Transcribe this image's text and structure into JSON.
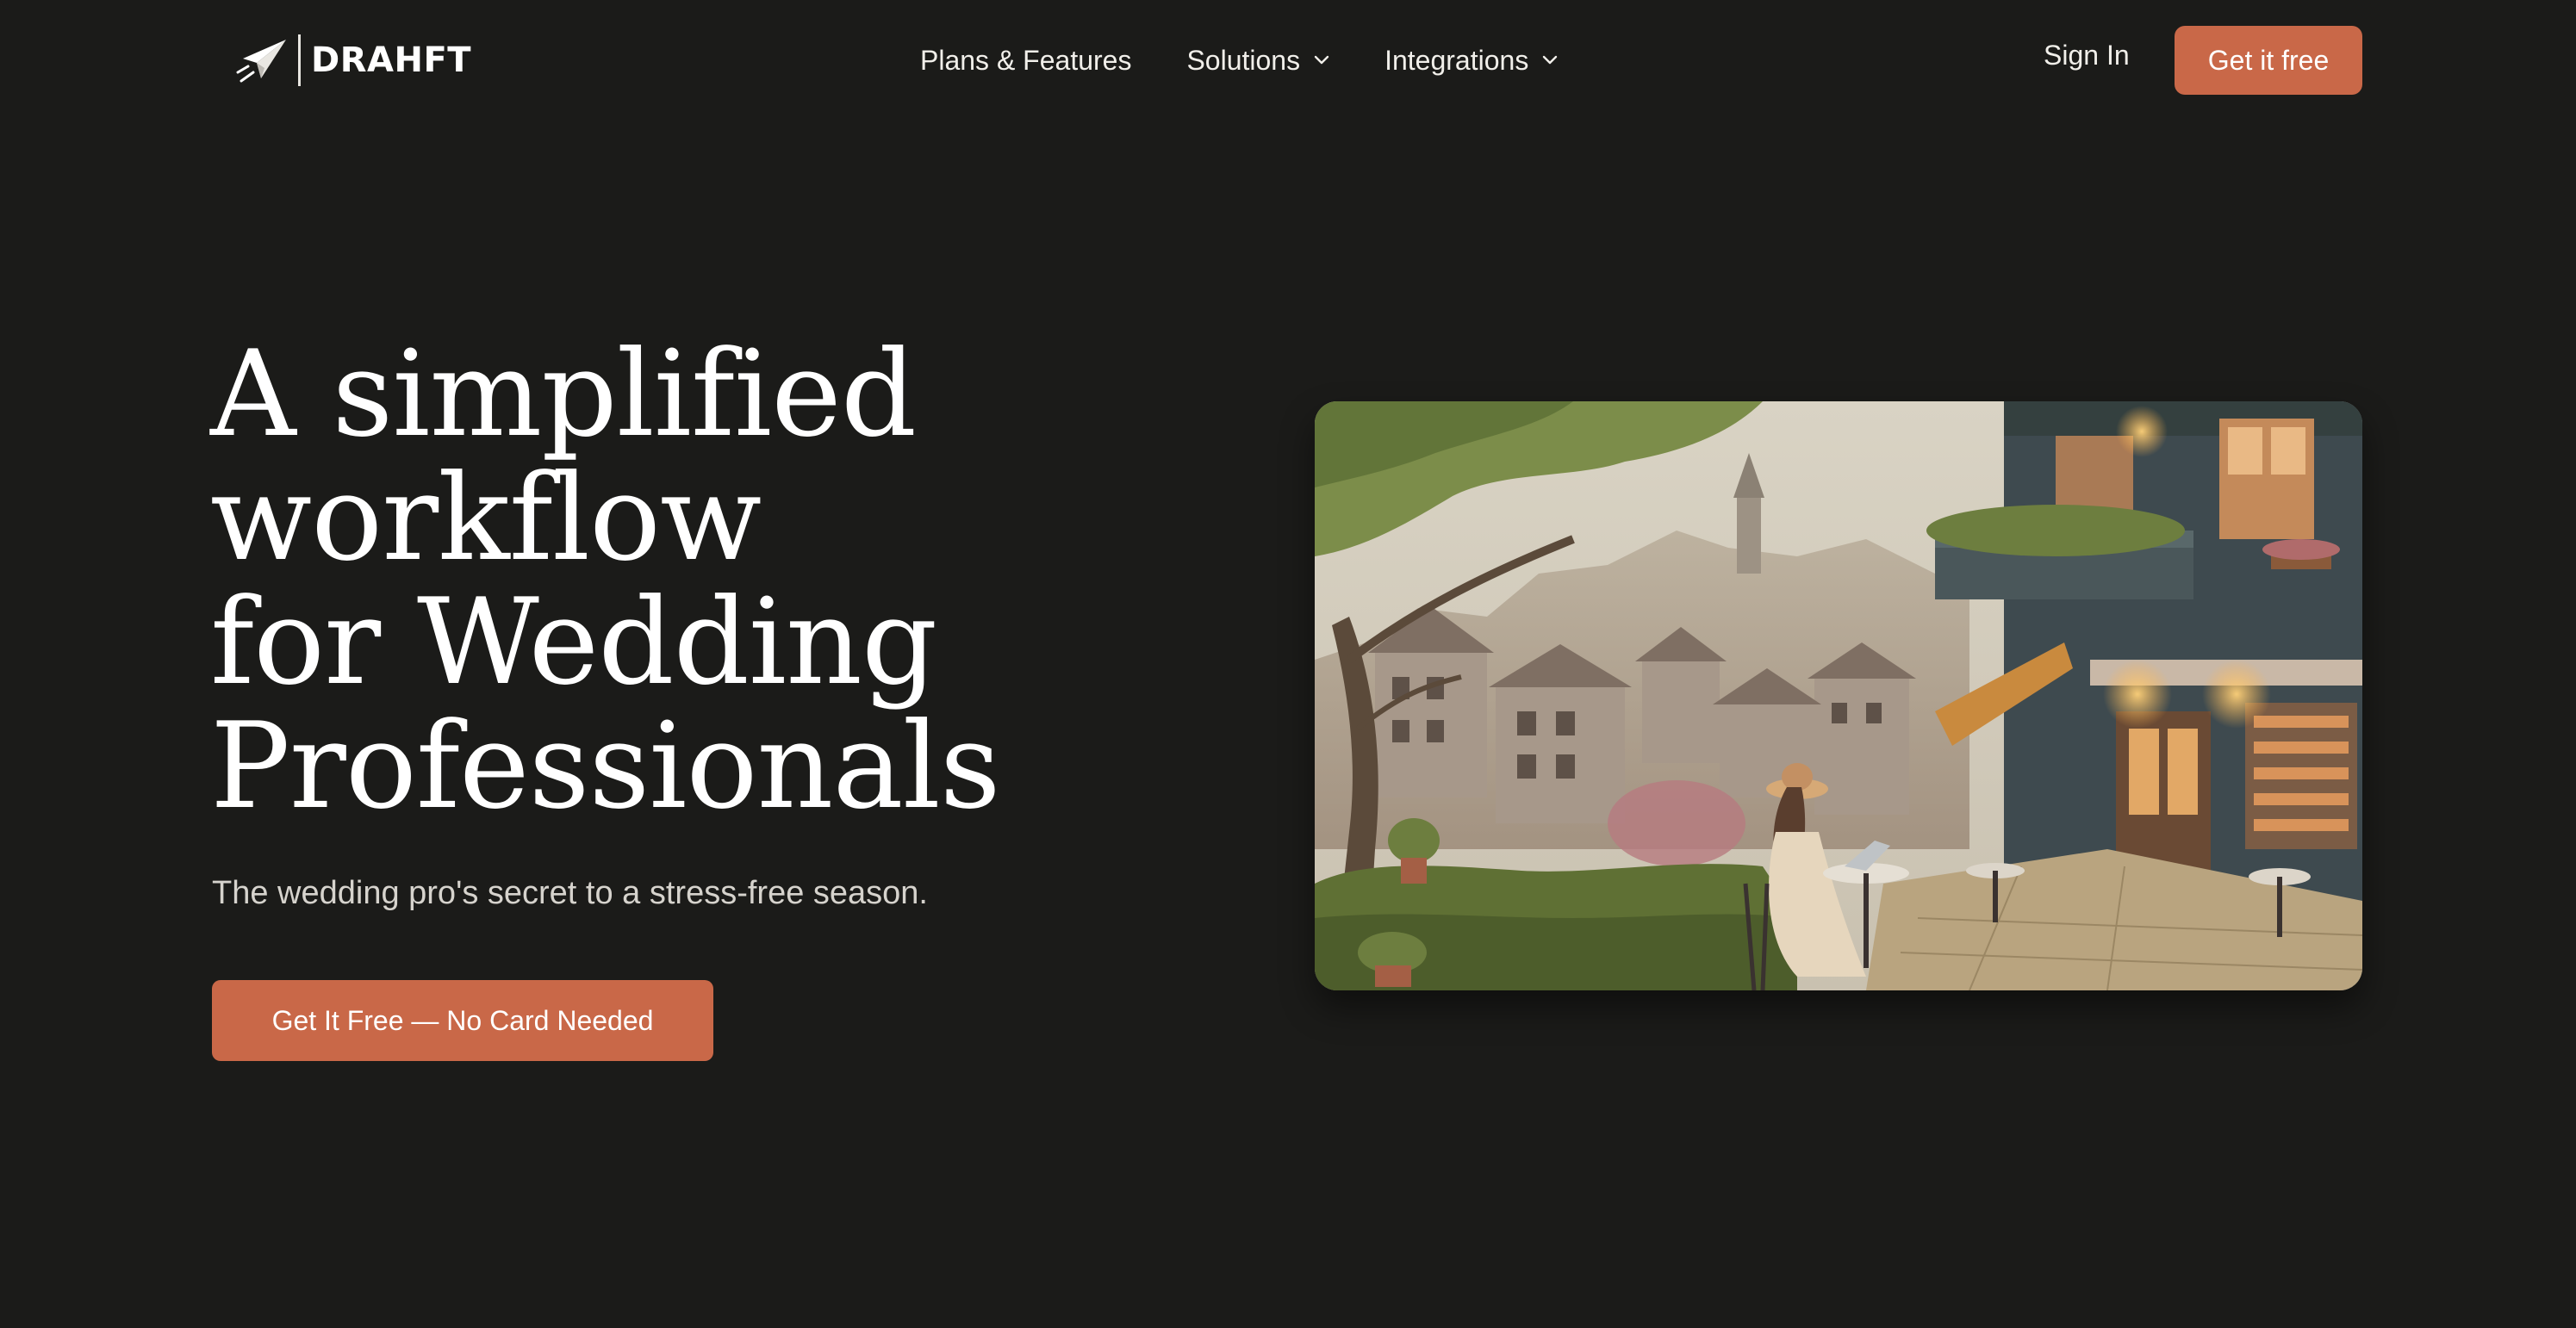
{
  "brand": {
    "name": "DRAHFT",
    "logo_icon": "paper-plane-icon",
    "accent_color": "#c96848",
    "background_color": "#1b1b19"
  },
  "nav": {
    "items": [
      {
        "label": "Plans & Features",
        "has_dropdown": false
      },
      {
        "label": "Solutions",
        "has_dropdown": true,
        "icon": "chevron-down-icon"
      },
      {
        "label": "Integrations",
        "has_dropdown": true,
        "icon": "chevron-down-icon"
      }
    ],
    "sign_in_label": "Sign In",
    "cta_label": "Get it free"
  },
  "hero": {
    "title_lines": [
      "A simplified",
      "workflow",
      "for Wedding",
      "Professionals"
    ],
    "subtitle": "The wedding pro's secret to a stress-free season.",
    "cta_label": "Get It Free — No Card Needed",
    "image_subject": "illustration"
  }
}
